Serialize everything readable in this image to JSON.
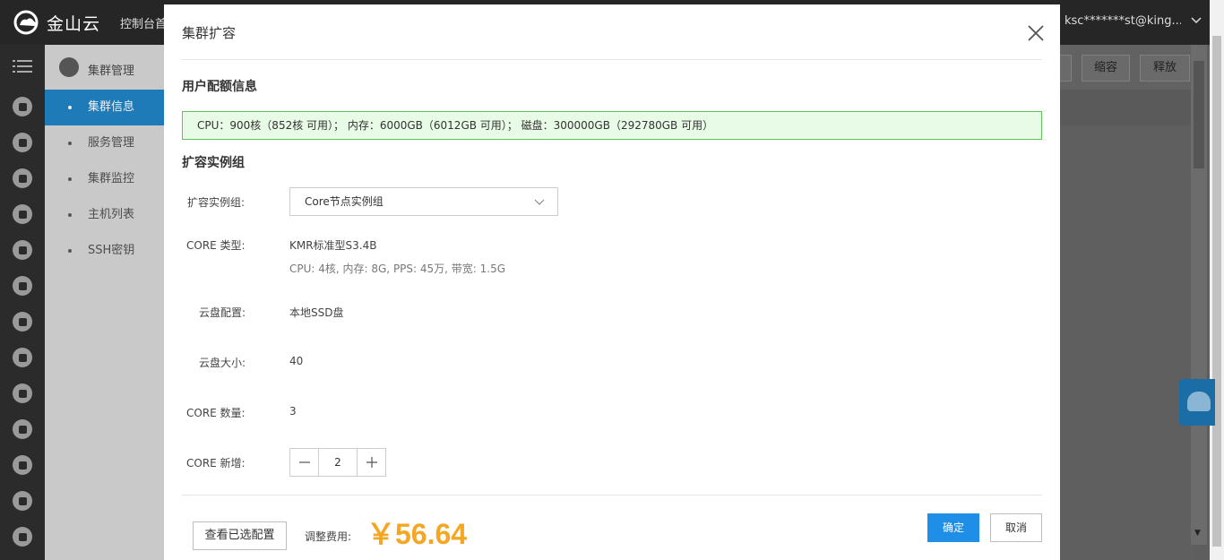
{
  "header": {
    "brand": "金山云",
    "console_link": "控制台首",
    "user": "ksc*******st@king..."
  },
  "sidenav": {
    "title": "集群管理",
    "items": [
      {
        "label": "集群信息",
        "active": true
      },
      {
        "label": "服务管理",
        "active": false
      },
      {
        "label": "集群监控",
        "active": false
      },
      {
        "label": "主机列表",
        "active": false
      },
      {
        "label": "SSH密钥",
        "active": false
      }
    ]
  },
  "toolbar": {
    "shrink_label": "缩容",
    "release_label": "释放"
  },
  "modal": {
    "title": "集群扩容",
    "quota_section_title": "用户配额信息",
    "quota_text": "CPU：900核（852核 可用）； 内存：6000GB（6012GB 可用）； 磁盘：300000GB（292780GB 可用）",
    "expand_section_title": "扩容实例组",
    "fields": {
      "group_label": "扩容实例组:",
      "group_value": "Core节点实例组",
      "core_type_label": "CORE 类型:",
      "core_type_value": "KMR标准型S3.4B",
      "core_type_spec": "CPU: 4核, 内存: 8G, PPS: 45万, 带宽: 1.5G",
      "disk_config_label": "云盘配置:",
      "disk_config_value": "本地SSD盘",
      "disk_size_label": "云盘大小:",
      "disk_size_value": "40",
      "core_count_label": "CORE 数量:",
      "core_count_value": "3",
      "core_add_label": "CORE 新增:",
      "core_add_value": "2"
    },
    "footer": {
      "view_config_label": "查看已选配置",
      "fee_label": "调整费用:",
      "fee_value": "￥56.64",
      "confirm_label": "确定",
      "cancel_label": "取消"
    }
  },
  "colors": {
    "accent": "#1e8ee6",
    "fee": "#f5a623",
    "quota_bg": "#e8fbe6",
    "quota_border": "#5ec45e",
    "nav_active": "#1e7bb8"
  }
}
